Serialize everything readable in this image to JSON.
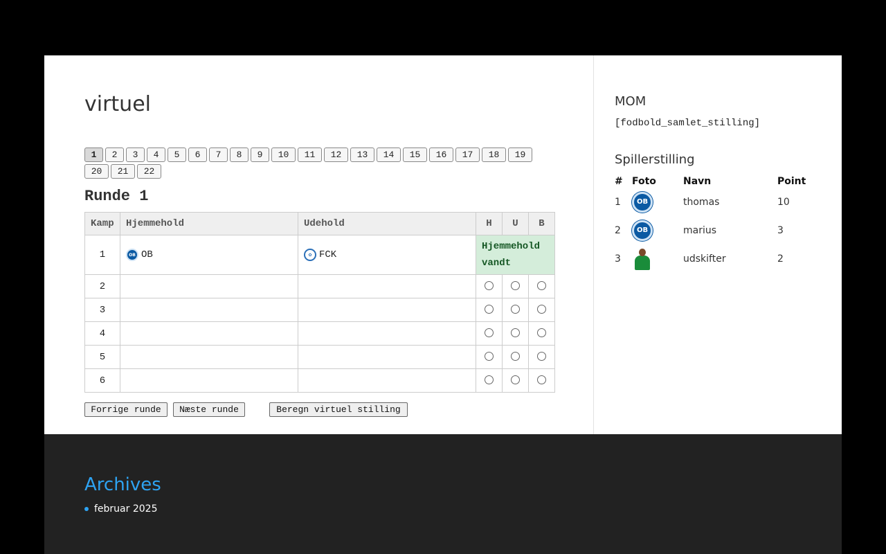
{
  "page_title": "virtuel",
  "pager": [
    "1",
    "2",
    "3",
    "4",
    "5",
    "6",
    "7",
    "8",
    "9",
    "10",
    "11",
    "12",
    "13",
    "14",
    "15",
    "16",
    "17",
    "18",
    "19",
    "20",
    "21",
    "22"
  ],
  "pager_active": "1",
  "round_title": "Runde 1",
  "table": {
    "headers": {
      "kamp": "Kamp",
      "home": "Hjemmehold",
      "away": "Udehold",
      "h": "H",
      "u": "U",
      "b": "B"
    },
    "rows": [
      {
        "kamp": "1",
        "home": "OB",
        "home_logo": "ob-logo",
        "away": "FCK",
        "away_logo": "fck-logo",
        "result": "Hjemmehold vandt"
      },
      {
        "kamp": "2",
        "home": "",
        "away": ""
      },
      {
        "kamp": "3",
        "home": "",
        "away": ""
      },
      {
        "kamp": "4",
        "home": "",
        "away": ""
      },
      {
        "kamp": "5",
        "home": "",
        "away": ""
      },
      {
        "kamp": "6",
        "home": "",
        "away": ""
      }
    ]
  },
  "actions": {
    "prev": "Forrige runde",
    "next": "Næste runde",
    "calc": "Beregn virtuel stilling"
  },
  "sidebar": {
    "mom_title": "MOM",
    "shortcode": "[fodbold_samlet_stilling]",
    "standings_title": "Spillerstilling",
    "headers": {
      "rank": "#",
      "photo": "Foto",
      "name": "Navn",
      "points": "Point"
    },
    "rows": [
      {
        "rank": "1",
        "photo": "ob-logo",
        "name": "thomas",
        "points": "10"
      },
      {
        "rank": "2",
        "photo": "ob-logo",
        "name": "marius",
        "points": "3"
      },
      {
        "rank": "3",
        "photo": "player-photo",
        "name": "udskifter",
        "points": "2"
      }
    ]
  },
  "footer": {
    "archives_title": "Archives",
    "archive_items": [
      "februar 2025"
    ]
  },
  "colors": {
    "accent": "#2ea3f2",
    "result_bg": "#d4edda",
    "result_text": "#155724",
    "club_blue": "#0b5aa3"
  }
}
